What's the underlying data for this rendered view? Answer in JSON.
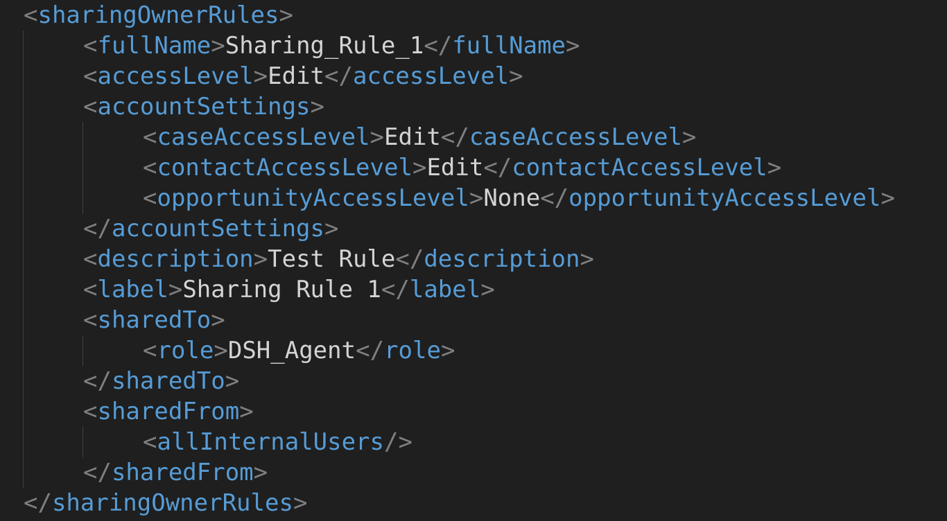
{
  "code": {
    "root_open": "sharingOwnerRules",
    "full_name_tag": "fullName",
    "full_name_value": "Sharing_Rule_1",
    "access_level_tag": "accessLevel",
    "access_level_value": "Edit",
    "account_settings_tag": "accountSettings",
    "case_access_tag": "caseAccessLevel",
    "case_access_value": "Edit",
    "contact_access_tag": "contactAccessLevel",
    "contact_access_value": "Edit",
    "opportunity_access_tag": "opportunityAccessLevel",
    "opportunity_access_value": "None",
    "description_tag": "description",
    "description_value": "Test Rule",
    "label_tag": "label",
    "label_value": "Sharing Rule 1",
    "shared_to_tag": "sharedTo",
    "role_tag": "role",
    "role_value": "DSH_Agent",
    "shared_from_tag": "sharedFrom",
    "all_internal_users_tag": "allInternalUsers"
  },
  "colors": {
    "background": "#1f1f1f",
    "tag": "#569cd6",
    "punctuation": "#808080",
    "text": "#d4d4d4"
  }
}
